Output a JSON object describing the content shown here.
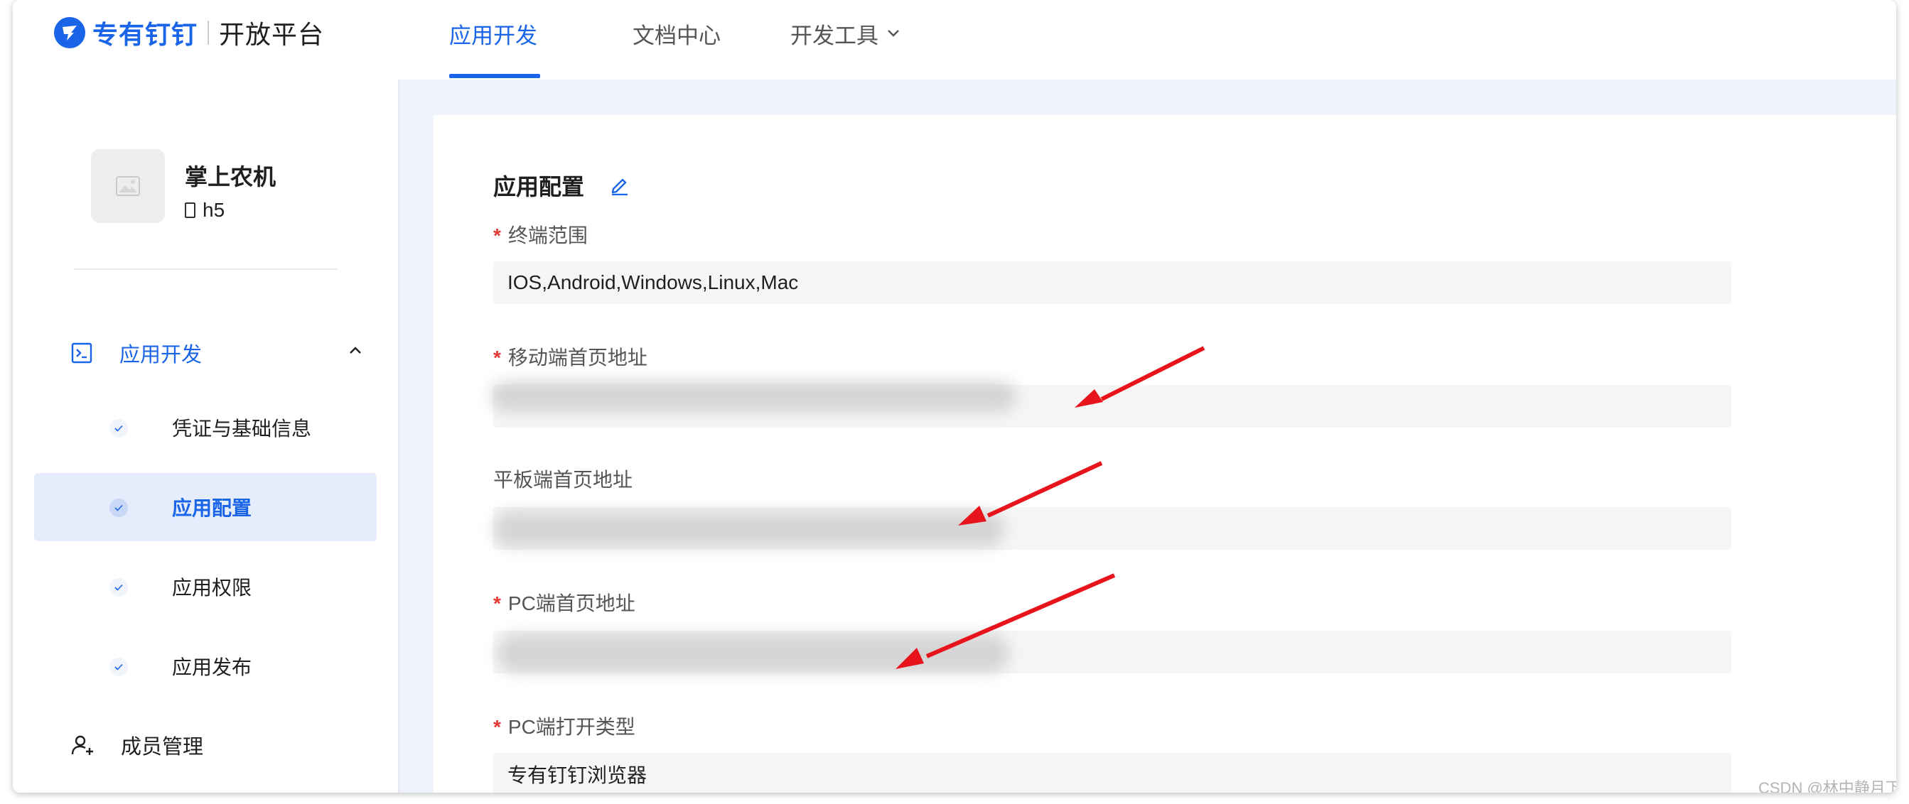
{
  "header": {
    "brand": "专有钉钉",
    "brand_sub": "开放平台",
    "tabs": [
      {
        "label": "应用开发",
        "active": true
      },
      {
        "label": "文档中心",
        "active": false
      },
      {
        "label": "开发工具",
        "active": false
      }
    ],
    "accent_color": "#1a64e8"
  },
  "sidebar": {
    "app_name": "掌上农机",
    "app_type": "h5",
    "group": {
      "label": "应用开发",
      "icon": "terminal-icon",
      "expanded": true
    },
    "items": [
      {
        "label": "凭证与基础信息",
        "active": false
      },
      {
        "label": "应用配置",
        "active": true
      },
      {
        "label": "应用权限",
        "active": false
      },
      {
        "label": "应用发布",
        "active": false
      }
    ],
    "member": {
      "label": "成员管理",
      "icon": "user-add-icon"
    }
  },
  "main": {
    "section_title": "应用配置",
    "fields": [
      {
        "label": "终端范围",
        "required": true,
        "value": "IOS,Android,Windows,Linux,Mac"
      },
      {
        "label": "移动端首页地址",
        "required": true,
        "value": ""
      },
      {
        "label": "平板端首页地址",
        "required": false,
        "value": ""
      },
      {
        "label": "PC端首页地址",
        "required": true,
        "value": ""
      },
      {
        "label": "PC端打开类型",
        "required": true,
        "value": "专有钉钉浏览器"
      }
    ],
    "required_mark": "*"
  },
  "watermark": "CSDN @林中静月下仙",
  "annotation_color": "#e8141b"
}
